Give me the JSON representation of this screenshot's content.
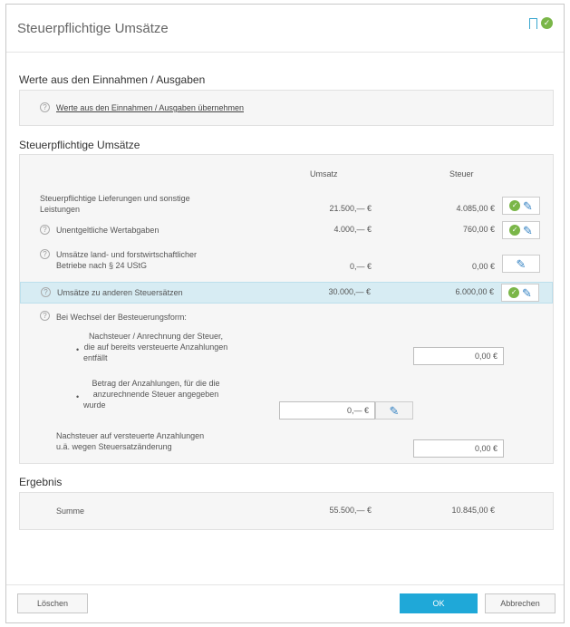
{
  "window": {
    "title": "Steuerpflichtige Umsätze"
  },
  "einnahmen": {
    "heading": "Werte aus den Einnahmen / Ausgaben",
    "link": "Werte aus den Einnahmen / Ausgaben übernehmen"
  },
  "umsaetze": {
    "heading": "Steuerpflichtige Umsätze",
    "col_umsatz": "Umsatz",
    "col_steuer": "Steuer",
    "rows": [
      {
        "label_l1": "Steuerpflichtige Lieferungen und sonstige",
        "label_l2": "Leistungen",
        "umsatz": "21.500,— €",
        "steuer": "4.085,00 €"
      },
      {
        "label_l1": "Unentgeltliche Wertabgaben",
        "umsatz": "4.000,— €",
        "steuer": "760,00 €"
      },
      {
        "label_l1": "Umsätze land- und forstwirtschaftlicher",
        "label_l2": "Betriebe nach § 24 UStG",
        "umsatz": "0,— €",
        "steuer": "0,00 €"
      },
      {
        "label_l1": "Umsätze zu anderen Steuersätzen",
        "umsatz": "30.000,— €",
        "steuer": "6.000,00 €"
      }
    ],
    "wechsel": {
      "label": "Bei Wechsel der Besteuerungsform:",
      "nachsteuer_l1": "Nachsteuer / Anrechnung der Steuer,",
      "nachsteuer_l2": "die auf bereits versteuerte Anzahlungen",
      "nachsteuer_l3": "entfällt",
      "nachsteuer_value": "0,00 €",
      "anzahlung_l1": "Betrag der Anzahlungen, für die die",
      "anzahlung_l2": "anzurechnende Steuer angegeben",
      "anzahlung_l3": "wurde",
      "anzahlung_value": "0,— €"
    },
    "steuersatz_l1": "Nachsteuer auf versteuerte Anzahlungen",
    "steuersatz_l2": "u.ä. wegen Steuersatzänderung",
    "steuersatz_value": "0,00 €"
  },
  "ergebnis": {
    "heading": "Ergebnis",
    "label": "Summe",
    "umsatz": "55.500,— €",
    "steuer": "10.845,00 €"
  },
  "buttons": {
    "delete": "Löschen",
    "ok": "OK",
    "cancel": "Abbrechen"
  },
  "icons": {
    "help": "?",
    "check": "✓",
    "pencil": "✎",
    "bullet": "•"
  },
  "colors": {
    "accent": "#1fa8d8",
    "ok_green": "#7ab648",
    "highlight_row": "#d7ecf3",
    "pencil_blue": "#2f7fc1"
  }
}
